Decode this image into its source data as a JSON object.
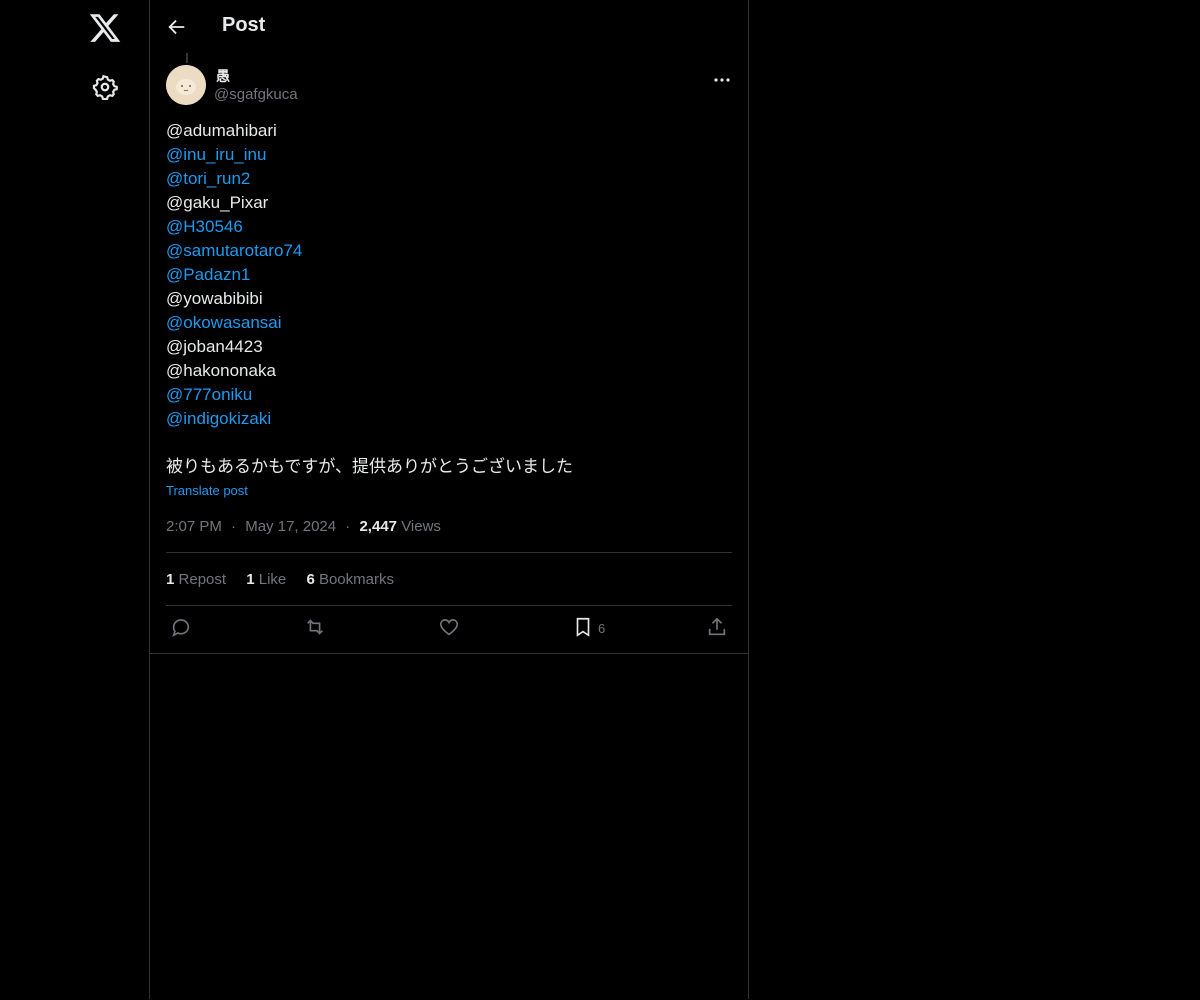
{
  "header": {
    "title": "Post",
    "back_label": "Back"
  },
  "author": {
    "display_name": "愚",
    "handle": "@sgafgkuca"
  },
  "post": {
    "mentions": [
      {
        "text": "@adumahibari",
        "is_link": false
      },
      {
        "text": "@inu_iru_inu",
        "is_link": true
      },
      {
        "text": "@tori_run2",
        "is_link": true
      },
      {
        "text": "@gaku_Pixar",
        "is_link": false
      },
      {
        "text": "@H30546",
        "is_link": true
      },
      {
        "text": "@samutarotaro74",
        "is_link": true
      },
      {
        "text": "@Padazn1",
        "is_link": true
      },
      {
        "text": "@yowabibibi",
        "is_link": false
      },
      {
        "text": "@okowasansai",
        "is_link": true
      },
      {
        "text": "@joban4423",
        "is_link": false
      },
      {
        "text": "@hakononaka",
        "is_link": false
      },
      {
        "text": "@777oniku",
        "is_link": true
      },
      {
        "text": "@indigokizaki",
        "is_link": true
      }
    ],
    "body": "被りもあるかもですが、提供ありがとうございました",
    "translate_label": "Translate post",
    "time": "2:07 PM",
    "date": "May 17, 2024",
    "views_count": "2,447",
    "views_label": "Views",
    "separator": "·"
  },
  "stats": {
    "reposts_count": "1",
    "reposts_label": "Repost",
    "likes_count": "1",
    "likes_label": "Like",
    "bookmarks_count": "6",
    "bookmarks_label": "Bookmarks"
  },
  "actions": {
    "bookmark_count": "6"
  },
  "icons": {
    "logo": "x-logo-icon",
    "settings": "gear-icon",
    "back": "arrow-left-icon",
    "more": "more-horizontal-icon",
    "reply": "reply-icon",
    "repost": "repost-icon",
    "like": "heart-icon",
    "bookmark": "bookmark-icon",
    "share": "share-icon"
  },
  "colors": {
    "background": "#000000",
    "text": "#e7e9ea",
    "secondary": "#71767b",
    "link": "#1d9bf0",
    "border": "#2f3336"
  }
}
